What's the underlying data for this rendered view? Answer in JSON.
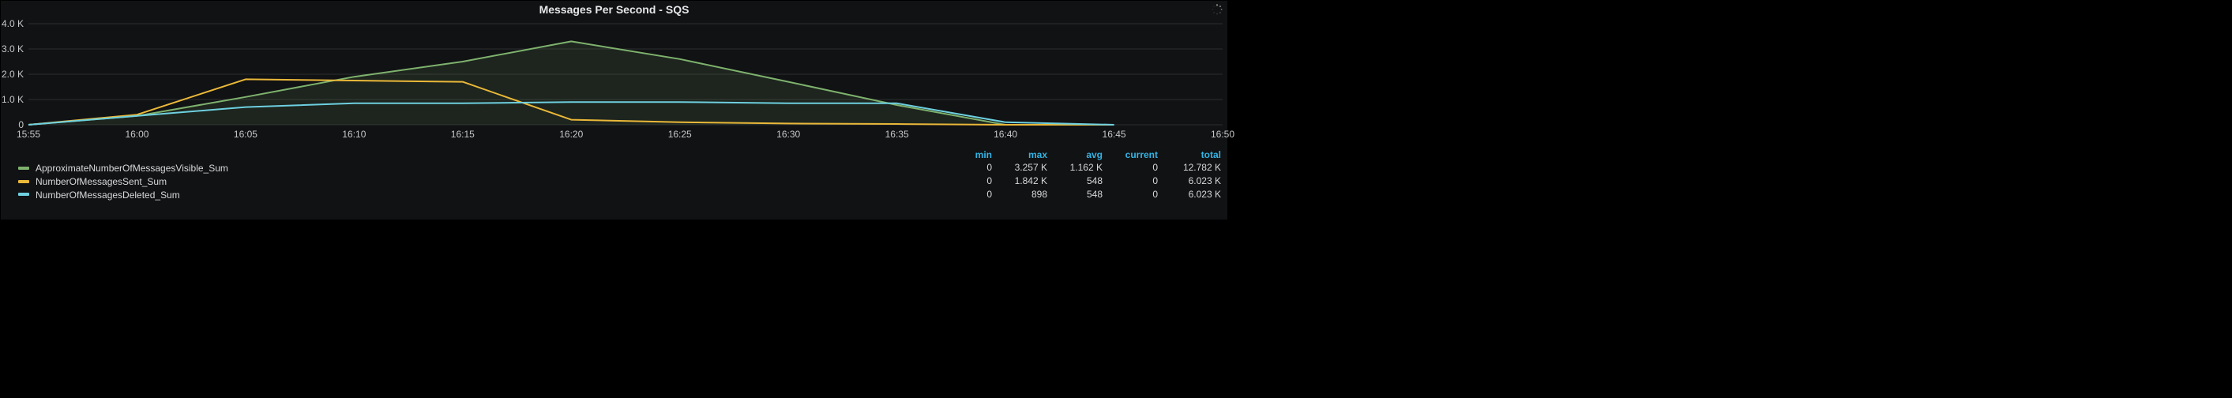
{
  "panel": {
    "title": "Messages Per Second - SQS"
  },
  "chart_data": {
    "type": "line",
    "title": "Messages Per Second - SQS",
    "xlabel": "",
    "ylabel": "",
    "ylim": [
      0,
      4000
    ],
    "x_ticks": [
      "15:55",
      "16:00",
      "16:05",
      "16:10",
      "16:15",
      "16:20",
      "16:25",
      "16:30",
      "16:35",
      "16:40",
      "16:45",
      "16:50"
    ],
    "y_ticks": [
      "0",
      "1.0 K",
      "2.0 K",
      "3.0 K",
      "4.0 K"
    ],
    "categories": [
      "15:55",
      "16:00",
      "16:05",
      "16:10",
      "16:15",
      "16:20",
      "16:25",
      "16:30",
      "16:35",
      "16:40",
      "16:45"
    ],
    "series": [
      {
        "name": "ApproximateNumberOfMessagesVisible_Sum",
        "color": "#7eb26d",
        "values": [
          0,
          350,
          1100,
          1900,
          2500,
          3300,
          2600,
          1700,
          780,
          0,
          0
        ]
      },
      {
        "name": "NumberOfMessagesSent_Sum",
        "color": "#eab839",
        "values": [
          0,
          400,
          1800,
          1750,
          1700,
          200,
          100,
          50,
          30,
          0,
          0
        ]
      },
      {
        "name": "NumberOfMessagesDeleted_Sum",
        "color": "#6ed0e0",
        "values": [
          0,
          350,
          700,
          850,
          850,
          900,
          900,
          850,
          850,
          100,
          0
        ]
      }
    ]
  },
  "legend": {
    "headers": {
      "min": "min",
      "max": "max",
      "avg": "avg",
      "current": "current",
      "total": "total"
    },
    "rows": [
      {
        "color": "#7eb26d",
        "name": "ApproximateNumberOfMessagesVisible_Sum",
        "min": "0",
        "max": "3.257 K",
        "avg": "1.162 K",
        "current": "0",
        "total": "12.782 K"
      },
      {
        "color": "#eab839",
        "name": "NumberOfMessagesSent_Sum",
        "min": "0",
        "max": "1.842 K",
        "avg": "548",
        "current": "0",
        "total": "6.023 K"
      },
      {
        "color": "#6ed0e0",
        "name": "NumberOfMessagesDeleted_Sum",
        "min": "0",
        "max": "898",
        "avg": "548",
        "current": "0",
        "total": "6.023 K"
      }
    ]
  }
}
